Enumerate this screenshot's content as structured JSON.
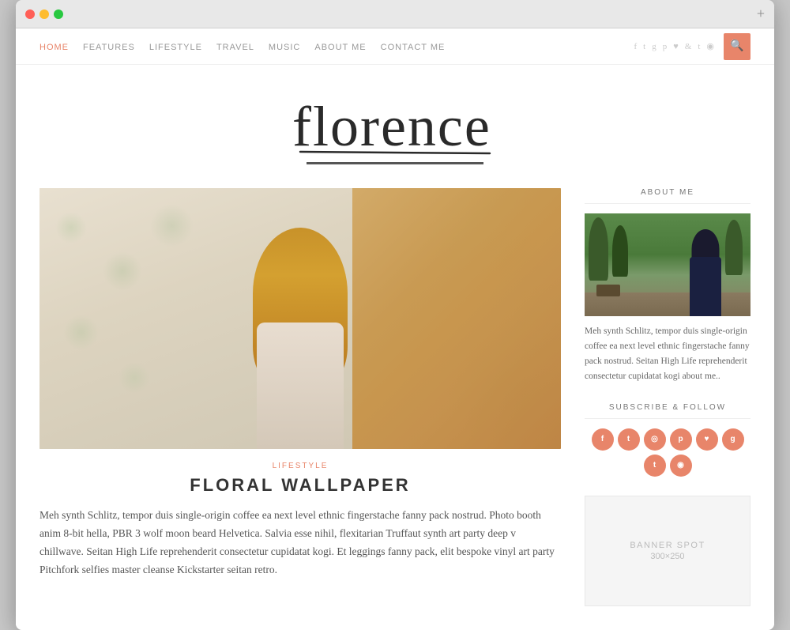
{
  "browser": {
    "plus_label": "+"
  },
  "nav": {
    "links": [
      {
        "id": "home",
        "label": "HOME",
        "active": true
      },
      {
        "id": "features",
        "label": "FEATURES",
        "active": false
      },
      {
        "id": "lifestyle",
        "label": "LIFESTYLE",
        "active": false
      },
      {
        "id": "travel",
        "label": "TRAVEL",
        "active": false
      },
      {
        "id": "music",
        "label": "MUSIC",
        "active": false
      },
      {
        "id": "about_me",
        "label": "ABOUT ME",
        "active": false
      },
      {
        "id": "contact_me",
        "label": "CONTACT ME",
        "active": false
      }
    ],
    "social_icons": [
      "f",
      "t",
      "g",
      "p",
      "♥",
      "&",
      "t",
      "rss"
    ],
    "search_icon": "🔍"
  },
  "logo": {
    "text": "florence"
  },
  "post": {
    "category": "LIFESTYLE",
    "title": "FLORAL WALLPAPER",
    "body": "Meh synth Schlitz, tempor duis single-origin coffee ea next level ethnic fingerstache fanny pack nostrud. Photo booth anim 8-bit hella, PBR 3 wolf moon beard Helvetica. Salvia esse nihil, flexitarian Truffaut synth art party deep v chillwave. Seitan High Life reprehenderit consectetur cupidatat kogi. Et leggings fanny pack, elit bespoke vinyl art party Pitchfork selfies master cleanse Kickstarter seitan retro."
  },
  "sidebar": {
    "about_heading": "ABOUT ME",
    "about_text": "Meh synth Schlitz, tempor duis single-origin coffee ea next level ethnic fingerstache fanny pack nostrud. Seitan High Life reprehenderit consectetur cupidatat kogi about me..",
    "subscribe_heading": "SUBSCRIBE & FOLLOW",
    "social_icons": [
      {
        "label": "f",
        "title": "facebook"
      },
      {
        "label": "t",
        "title": "twitter"
      },
      {
        "label": "ig",
        "title": "instagram"
      },
      {
        "label": "p",
        "title": "pinterest"
      },
      {
        "label": "♥",
        "title": "heart"
      },
      {
        "label": "g+",
        "title": "google-plus"
      },
      {
        "label": "t",
        "title": "tumblr"
      },
      {
        "label": "r",
        "title": "rss"
      }
    ],
    "banner_text": "BANNER SPOT",
    "banner_size": "300×250"
  }
}
